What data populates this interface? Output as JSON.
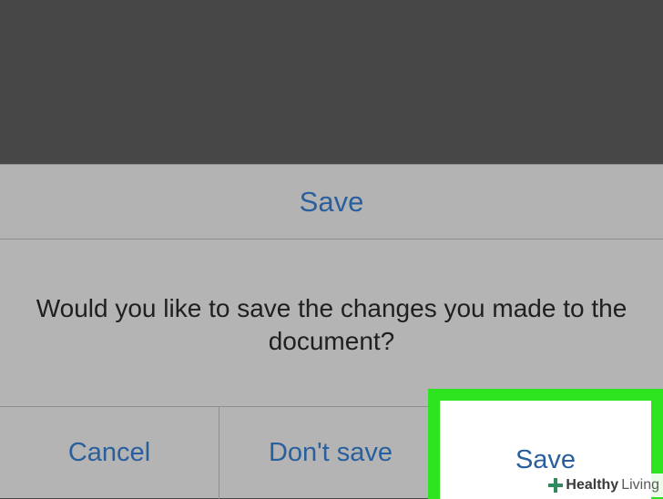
{
  "dialog": {
    "title": "Save",
    "message": "Would you like to save the changes you made to the document?",
    "buttons": {
      "cancel": "Cancel",
      "dont_save": "Don't save",
      "save": "Save"
    }
  },
  "watermark": {
    "brand_bold": "Healthy",
    "brand_light": "Living",
    "icon": "plus-icon"
  },
  "colors": {
    "accent_text": "#2a5f9e",
    "highlight": "#2ee41e",
    "dialog_bg": "#b4b4b4",
    "backdrop": "#474747"
  }
}
